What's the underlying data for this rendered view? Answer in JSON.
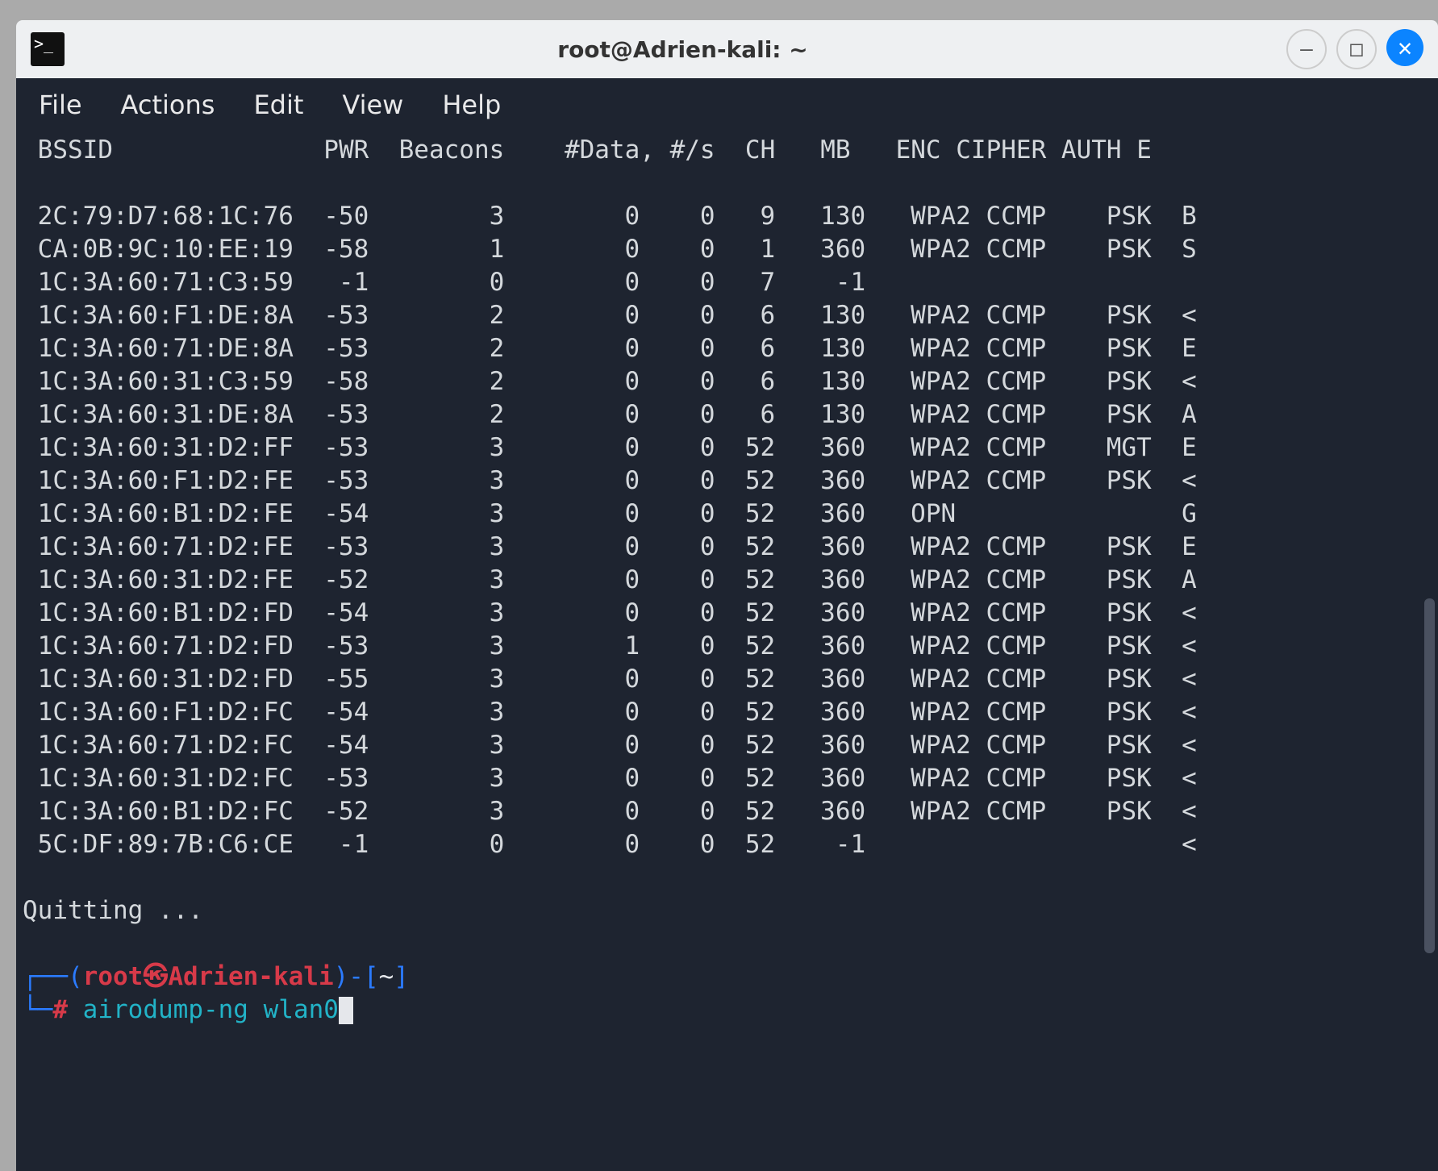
{
  "window": {
    "title": "root@Adrien-kali: ~",
    "minimize": "–",
    "maximize": "□",
    "close": "✕"
  },
  "menubar": [
    "File",
    "Actions",
    "Edit",
    "View",
    "Help"
  ],
  "headers": {
    "bssid": "BSSID",
    "pwr": "PWR",
    "beacons": "Beacons",
    "data": "#Data,",
    "ps": "#/s",
    "ch": "CH",
    "mb": "MB",
    "enc": "ENC",
    "cipher": "CIPHER",
    "auth": "AUTH",
    "e": "E"
  },
  "rows": [
    {
      "bssid": "2C:79:D7:68:1C:76",
      "pwr": "-50",
      "beacons": "3",
      "data": "0",
      "ps": "0",
      "ch": "9",
      "mb": "130",
      "enc": "WPA2",
      "cipher": "CCMP",
      "auth": "PSK",
      "e": "B"
    },
    {
      "bssid": "CA:0B:9C:10:EE:19",
      "pwr": "-58",
      "beacons": "1",
      "data": "0",
      "ps": "0",
      "ch": "1",
      "mb": "360",
      "enc": "WPA2",
      "cipher": "CCMP",
      "auth": "PSK",
      "e": "S"
    },
    {
      "bssid": "1C:3A:60:71:C3:59",
      "pwr": "-1",
      "beacons": "0",
      "data": "0",
      "ps": "0",
      "ch": "7",
      "mb": "-1",
      "enc": "",
      "cipher": "",
      "auth": "",
      "e": ""
    },
    {
      "bssid": "1C:3A:60:F1:DE:8A",
      "pwr": "-53",
      "beacons": "2",
      "data": "0",
      "ps": "0",
      "ch": "6",
      "mb": "130",
      "enc": "WPA2",
      "cipher": "CCMP",
      "auth": "PSK",
      "e": "<"
    },
    {
      "bssid": "1C:3A:60:71:DE:8A",
      "pwr": "-53",
      "beacons": "2",
      "data": "0",
      "ps": "0",
      "ch": "6",
      "mb": "130",
      "enc": "WPA2",
      "cipher": "CCMP",
      "auth": "PSK",
      "e": "E"
    },
    {
      "bssid": "1C:3A:60:31:C3:59",
      "pwr": "-58",
      "beacons": "2",
      "data": "0",
      "ps": "0",
      "ch": "6",
      "mb": "130",
      "enc": "WPA2",
      "cipher": "CCMP",
      "auth": "PSK",
      "e": "<"
    },
    {
      "bssid": "1C:3A:60:31:DE:8A",
      "pwr": "-53",
      "beacons": "2",
      "data": "0",
      "ps": "0",
      "ch": "6",
      "mb": "130",
      "enc": "WPA2",
      "cipher": "CCMP",
      "auth": "PSK",
      "e": "A"
    },
    {
      "bssid": "1C:3A:60:31:D2:FF",
      "pwr": "-53",
      "beacons": "3",
      "data": "0",
      "ps": "0",
      "ch": "52",
      "mb": "360",
      "enc": "WPA2",
      "cipher": "CCMP",
      "auth": "MGT",
      "e": "E"
    },
    {
      "bssid": "1C:3A:60:F1:D2:FE",
      "pwr": "-53",
      "beacons": "3",
      "data": "0",
      "ps": "0",
      "ch": "52",
      "mb": "360",
      "enc": "WPA2",
      "cipher": "CCMP",
      "auth": "PSK",
      "e": "<"
    },
    {
      "bssid": "1C:3A:60:B1:D2:FE",
      "pwr": "-54",
      "beacons": "3",
      "data": "0",
      "ps": "0",
      "ch": "52",
      "mb": "360",
      "enc": "OPN",
      "cipher": "",
      "auth": "",
      "e": "G"
    },
    {
      "bssid": "1C:3A:60:71:D2:FE",
      "pwr": "-53",
      "beacons": "3",
      "data": "0",
      "ps": "0",
      "ch": "52",
      "mb": "360",
      "enc": "WPA2",
      "cipher": "CCMP",
      "auth": "PSK",
      "e": "E"
    },
    {
      "bssid": "1C:3A:60:31:D2:FE",
      "pwr": "-52",
      "beacons": "3",
      "data": "0",
      "ps": "0",
      "ch": "52",
      "mb": "360",
      "enc": "WPA2",
      "cipher": "CCMP",
      "auth": "PSK",
      "e": "A"
    },
    {
      "bssid": "1C:3A:60:B1:D2:FD",
      "pwr": "-54",
      "beacons": "3",
      "data": "0",
      "ps": "0",
      "ch": "52",
      "mb": "360",
      "enc": "WPA2",
      "cipher": "CCMP",
      "auth": "PSK",
      "e": "<"
    },
    {
      "bssid": "1C:3A:60:71:D2:FD",
      "pwr": "-53",
      "beacons": "3",
      "data": "1",
      "ps": "0",
      "ch": "52",
      "mb": "360",
      "enc": "WPA2",
      "cipher": "CCMP",
      "auth": "PSK",
      "e": "<"
    },
    {
      "bssid": "1C:3A:60:31:D2:FD",
      "pwr": "-55",
      "beacons": "3",
      "data": "0",
      "ps": "0",
      "ch": "52",
      "mb": "360",
      "enc": "WPA2",
      "cipher": "CCMP",
      "auth": "PSK",
      "e": "<"
    },
    {
      "bssid": "1C:3A:60:F1:D2:FC",
      "pwr": "-54",
      "beacons": "3",
      "data": "0",
      "ps": "0",
      "ch": "52",
      "mb": "360",
      "enc": "WPA2",
      "cipher": "CCMP",
      "auth": "PSK",
      "e": "<"
    },
    {
      "bssid": "1C:3A:60:71:D2:FC",
      "pwr": "-54",
      "beacons": "3",
      "data": "0",
      "ps": "0",
      "ch": "52",
      "mb": "360",
      "enc": "WPA2",
      "cipher": "CCMP",
      "auth": "PSK",
      "e": "<"
    },
    {
      "bssid": "1C:3A:60:31:D2:FC",
      "pwr": "-53",
      "beacons": "3",
      "data": "0",
      "ps": "0",
      "ch": "52",
      "mb": "360",
      "enc": "WPA2",
      "cipher": "CCMP",
      "auth": "PSK",
      "e": "<"
    },
    {
      "bssid": "1C:3A:60:B1:D2:FC",
      "pwr": "-52",
      "beacons": "3",
      "data": "0",
      "ps": "0",
      "ch": "52",
      "mb": "360",
      "enc": "WPA2",
      "cipher": "CCMP",
      "auth": "PSK",
      "e": "<"
    },
    {
      "bssid": "5C:DF:89:7B:C6:CE",
      "pwr": "-1",
      "beacons": "0",
      "data": "0",
      "ps": "0",
      "ch": "52",
      "mb": "-1",
      "enc": "",
      "cipher": "",
      "auth": "",
      "e": "<"
    }
  ],
  "quitting": "Quitting ...",
  "prompt": {
    "user": "root",
    "sym": "㉿",
    "host": "Adrien-kali",
    "path": "~",
    "hash": "#",
    "command": "airodump-ng wlan0"
  }
}
